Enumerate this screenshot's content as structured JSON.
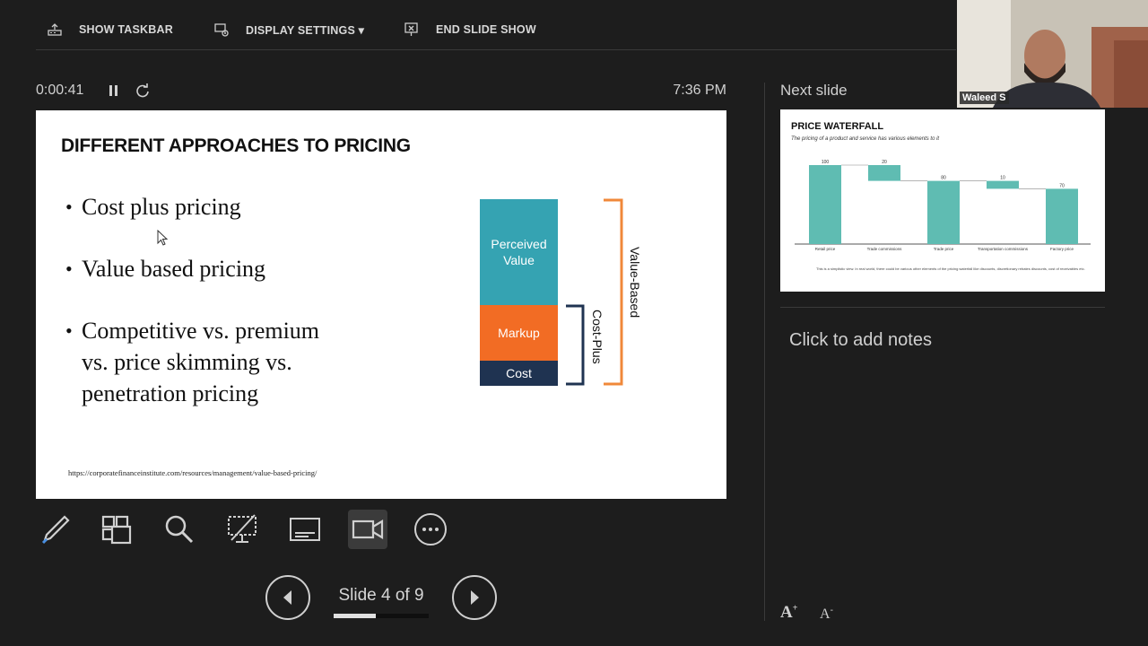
{
  "topbar": {
    "show_taskbar": "SHOW TASKBAR",
    "display_settings": "DISPLAY SETTINGS ▾",
    "end_slide_show": "END SLIDE SHOW"
  },
  "timer": {
    "elapsed": "0:00:41",
    "clock": "7:36 PM"
  },
  "slide": {
    "title": "DIFFERENT APPROACHES TO PRICING",
    "bullets": [
      "Cost plus pricing",
      "Value based pricing",
      "Competitive vs. premium vs. price skimming vs. penetration pricing"
    ],
    "bullet_lines": {
      "b3_l1": "Competitive vs. premium",
      "b3_l2": "vs. price skimming vs.",
      "b3_l3": "penetration pricing"
    },
    "url": "https://corporatefinanceinstitute.com/resources/management/value-based-pricing/",
    "diagram": {
      "blocks": [
        "Perceived Value",
        "Markup",
        "Cost"
      ],
      "block_lines": {
        "pv_1": "Perceived",
        "pv_2": "Value"
      },
      "brackets": [
        "Cost-Plus",
        "Value-Based"
      ],
      "colors": {
        "perceived": "#35a3b2",
        "markup": "#f26c24",
        "cost": "#1f3351",
        "value_bracket": "#f0883a",
        "cost_bracket": "#1f3351"
      }
    }
  },
  "toolbar": {
    "tools": [
      "pen-tool",
      "see-all-slides",
      "zoom",
      "black-screen",
      "subtitles",
      "camera",
      "more-options"
    ]
  },
  "navigation": {
    "slide_count": "Slide 4 of 9",
    "progress": 0.444
  },
  "next_slide": {
    "label": "Next slide",
    "title": "PRICE WATERFALL",
    "subtitle": "The pricing of a product and service has various elements to it",
    "bar_labels": [
      "100",
      "20",
      "80",
      "10",
      "70"
    ],
    "categories": [
      "Retail price",
      "Trade commissions",
      "Trade price",
      "Transportation commissions",
      "Factory price"
    ],
    "footnote": "This is a simplistic view. In real world, there could be various other elements of the pricing waterfall like discounts, discretionary rebates discounts, cost of receivables etc.",
    "bar_color": "#5fbcb2"
  },
  "notes": {
    "placeholder": "Click to add notes"
  },
  "webcam": {
    "name": "Waleed S"
  },
  "colors": {
    "background": "#1d1d1d",
    "text": "#d6d6d6"
  }
}
